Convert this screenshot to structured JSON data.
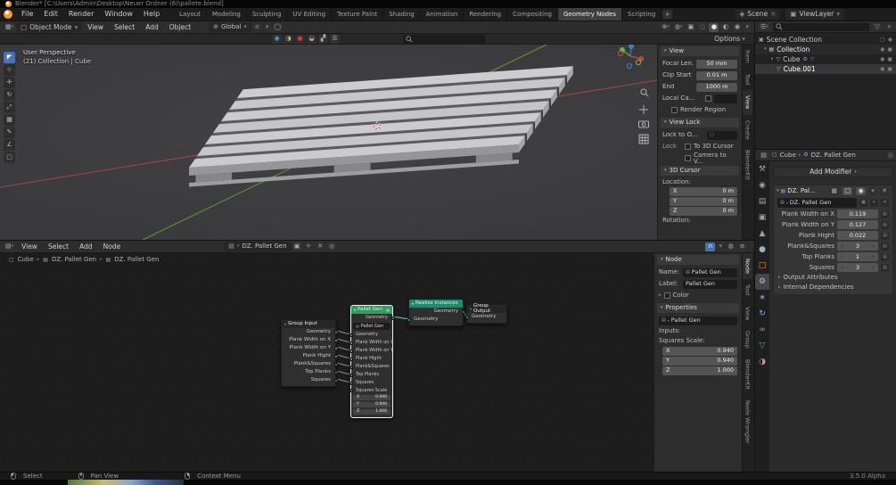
{
  "titlebar": {
    "title": "Blender* [C:\\Users\\Admin\\Desktop\\Neuer Ordner (6)\\pallete.blend]"
  },
  "menubar": {
    "menus": [
      "File",
      "Edit",
      "Render",
      "Window",
      "Help"
    ],
    "workspaces": [
      "Layout",
      "Modeling",
      "Sculpting",
      "UV Editing",
      "Texture Paint",
      "Shading",
      "Animation",
      "Rendering",
      "Compositing",
      "Geometry Nodes",
      "Scripting"
    ],
    "add_workspace": "+",
    "scene": "Scene",
    "viewlayer": "ViewLayer"
  },
  "viewport": {
    "mode": "Object Mode",
    "menus": [
      "View",
      "Select",
      "Add",
      "Object"
    ],
    "orientation": "Global",
    "options": "Options",
    "overlay_line1": "User Perspective",
    "overlay_line2": "(21) Collection | Cube",
    "npanel": {
      "section_view": "View",
      "focal_label": "Focal Len.",
      "focal_value": "50 mm",
      "clip_label": "Clip Start",
      "clip_value": "0.01 m",
      "end_label": "End",
      "end_value": "1000 m",
      "local_label": "Local Ca...",
      "render_region": "Render Region",
      "section_lock": "View Lock",
      "lock_to_label": "Lock to O...",
      "lock_label": "Lock",
      "to_cursor": "To 3D Cursor",
      "camera_to_view": "Camera to V...",
      "section_cursor": "3D Cursor",
      "location_label": "Location:",
      "loc_x_axis": "X",
      "loc_x": "0 m",
      "loc_y_axis": "Y",
      "loc_y": "0 m",
      "loc_z_axis": "Z",
      "loc_z": "0 m",
      "rotation_label": "Rotation:"
    },
    "side_tabs": [
      "Item",
      "Tool",
      "View",
      "Create",
      "BlenderKit"
    ]
  },
  "outliner": {
    "rows": [
      {
        "name": "Scene Collection"
      },
      {
        "name": "Collection"
      },
      {
        "name": "Cube"
      },
      {
        "name": "Cube.001"
      }
    ]
  },
  "properties": {
    "breadcrumb_object": "Cube",
    "breadcrumb_modifier": "DZ. Pallet Gen",
    "add_modifier": "Add Modifier",
    "modifier_header": "DZ. Pal...",
    "group_name": "DZ. Pallet Gen",
    "params": [
      {
        "label": "Plank Width on X",
        "value": "0.119"
      },
      {
        "label": "Plank Width on Y",
        "value": "0.127"
      },
      {
        "label": "Plank Hight",
        "value": "0.022"
      },
      {
        "label": "Plank&Squares",
        "value": "3"
      },
      {
        "label": "Top Planks",
        "value": "1"
      },
      {
        "label": "Squares",
        "value": "3"
      }
    ],
    "output_attributes": "Output Attributes",
    "internal_dependencies": "Internal Dependencies"
  },
  "node_editor": {
    "menus": [
      "View",
      "Select",
      "Add",
      "Node"
    ],
    "tree_name": "DZ. Pallet Gen",
    "breadcrumb": [
      "Cube",
      "DZ. Pallet Gen",
      "DZ. Pallet Gen"
    ],
    "group_input": {
      "title": "Group Input",
      "outputs": [
        "Geometry",
        "Plank Width on X",
        "Plank Width on Y",
        "Plank Hight",
        "Plank&Squares",
        "Top Planks",
        "Squares"
      ]
    },
    "pallet_gen": {
      "title": "Pallet Gen",
      "output": "Geometry",
      "group_field": "Pallet Gen",
      "inputs": [
        "Geometry",
        "Plank Width on X",
        "Plank Width on Y",
        "Plank Hight",
        "Plank&Squares",
        "Top Planks",
        "Squares"
      ],
      "vector_label": "Squares Scale",
      "vec": [
        {
          "axis": "X",
          "value": "0.940"
        },
        {
          "axis": "Y",
          "value": "0.940"
        },
        {
          "axis": "Z",
          "value": "1.000"
        }
      ]
    },
    "realize": {
      "title": "Realize Instances",
      "output": "Geometry",
      "input": "Geometry"
    },
    "group_output": {
      "title": "Group Output",
      "input": "Geometry"
    },
    "npanel": {
      "section_node": "Node",
      "name_label": "Name:",
      "name_value": "Pallet Gen",
      "label_label": "Label:",
      "label_value": "Pallet Gen",
      "color_label": "Color",
      "section_props": "Properties",
      "group_value": "Pallet Gen",
      "inputs_label": "Inputs:",
      "scale_label": "Squares Scale:",
      "scale": [
        {
          "axis": "X",
          "value": "0.940"
        },
        {
          "axis": "Y",
          "value": "0.940"
        },
        {
          "axis": "Z",
          "value": "1.000"
        }
      ]
    },
    "side_tabs": [
      "Node",
      "Tool",
      "View",
      "Group",
      "BlenderKit",
      "Node Wrangler"
    ]
  },
  "statusbar": {
    "items": [
      "Select",
      "Pan View",
      "Context Menu"
    ],
    "version": "3.5.0 Alpha"
  }
}
